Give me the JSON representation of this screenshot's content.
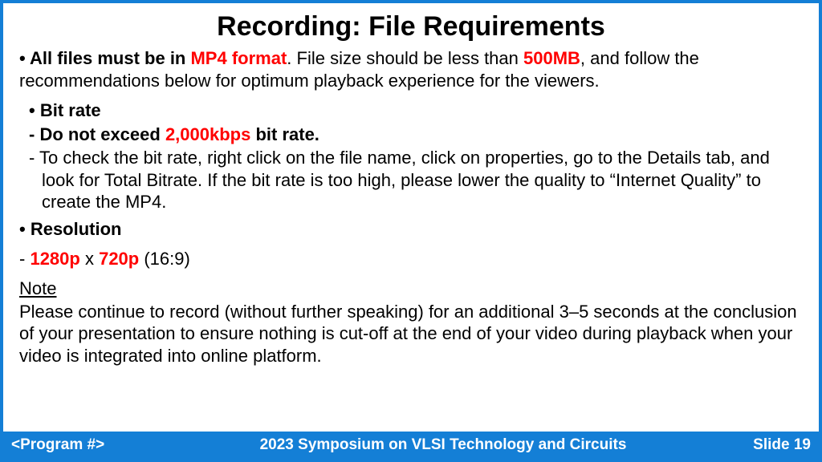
{
  "title": "Recording: File Requirements",
  "line1": {
    "bullet": "• ",
    "a": "All files must be in ",
    "b": "MP4 format",
    "c": ". File size should be less than ",
    "d": "500MB",
    "e": ", and follow the recommendations below for optimum playback experience for the viewers."
  },
  "bitrate": {
    "head_bullet": "•  ",
    "head": "Bit rate",
    "l1_dash": "-  ",
    "l1_a": "Do not exceed ",
    "l1_b": "2,000kbps",
    "l1_c": " bit rate.",
    "l2_dash": "-  ",
    "l2": "To check the bit rate, right click on the file name, click on properties, go to the Details tab, and look for Total Bitrate. If the bit rate is too high, please lower the quality to “Internet Quality” to create the MP4."
  },
  "resolution": {
    "head_bullet": "• ",
    "head": "Resolution",
    "l1_dash": "- ",
    "l1_a": "1280p",
    "l1_b": " x ",
    "l1_c": "720p",
    "l1_d": " (16:9)"
  },
  "note": {
    "head": "Note",
    "body": "Please continue to record (without further speaking) for an additional 3–5 seconds at the conclusion of your presentation to ensure nothing is cut-off at the end of your video during playback when your video is integrated into online platform."
  },
  "footer": {
    "left": "<Program #>",
    "center": "2023 Symposium on VLSI Technology and Circuits",
    "right": "Slide 19"
  }
}
